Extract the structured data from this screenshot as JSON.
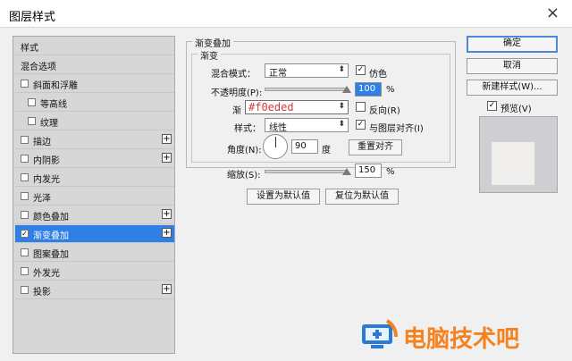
{
  "window": {
    "title": "图层样式",
    "close_glyph": "×"
  },
  "left_panel": {
    "items": [
      {
        "label": "样式",
        "checkbox": false
      },
      {
        "label": "混合选项",
        "checkbox": false
      },
      {
        "label": "斜面和浮雕",
        "checkbox": true,
        "checked": false
      },
      {
        "label": "等高线",
        "checkbox": true,
        "checked": false,
        "indent": true
      },
      {
        "label": "纹理",
        "checkbox": true,
        "checked": false,
        "indent": true
      },
      {
        "label": "描边",
        "checkbox": true,
        "checked": false,
        "plus": true
      },
      {
        "label": "内阴影",
        "checkbox": true,
        "checked": false,
        "plus": true
      },
      {
        "label": "内发光",
        "checkbox": true,
        "checked": false
      },
      {
        "label": "光泽",
        "checkbox": true,
        "checked": false
      },
      {
        "label": "颜色叠加",
        "checkbox": true,
        "checked": false,
        "plus": true
      },
      {
        "label": "渐变叠加",
        "checkbox": true,
        "checked": true,
        "plus": true,
        "selected": true
      },
      {
        "label": "图案叠加",
        "checkbox": true,
        "checked": false
      },
      {
        "label": "外发光",
        "checkbox": true,
        "checked": false
      },
      {
        "label": "投影",
        "checkbox": true,
        "checked": false,
        "plus": true
      }
    ],
    "plus_glyph": "+"
  },
  "gradient_overlay": {
    "section_title": "渐变叠加",
    "group_title": "渐变",
    "blend_mode_label": "混合模式：",
    "blend_mode_value": "正常",
    "dither_label": "仿色",
    "dither_checked": true,
    "opacity_label": "不透明度(P):",
    "opacity_value": "100",
    "opacity_fraction": 1.0,
    "percent": "%",
    "gradient_label": "渐",
    "gradient_hex": "#f0eded",
    "reverse_label": "反向(R)",
    "reverse_checked": false,
    "style_label": "样式：",
    "style_value": "线性",
    "align_label": "与图层对齐(I)",
    "align_checked": true,
    "angle_label": "角度(N):",
    "angle_value": "90",
    "angle_unit": "度",
    "reset_align_label": "重置对齐",
    "scale_label": "缩放(S):",
    "scale_value": "150",
    "scale_fraction": 1.0,
    "set_default_label": "设置为默认值",
    "reset_default_label": "复位为默认值"
  },
  "right_buttons": {
    "ok": "确定",
    "cancel": "取消",
    "new_style": "新建样式(W)...",
    "preview_label": "预览(V)",
    "preview_checked": true
  },
  "watermark": {
    "text": "电脑技术吧"
  },
  "colors": {
    "accent": "#2f7fe5",
    "preview_fill": "#f0eded",
    "watermark": "#f58220"
  },
  "icons": {
    "check": "✓",
    "dropdown": "⬍"
  }
}
